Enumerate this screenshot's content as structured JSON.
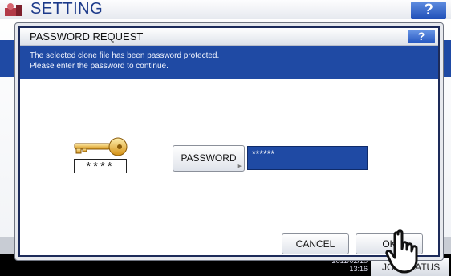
{
  "background": {
    "title": "SETTING",
    "help_label": "?",
    "datetime": "2011/02/10\n13:16",
    "job_status_label": "JOB STATUS"
  },
  "dialog": {
    "title": "PASSWORD REQUEST",
    "help_label": "?",
    "message_line1": "The selected clone file has been password protected.",
    "message_line2": "Please enter the password to continue.",
    "mask_text": "****",
    "password_button_label": "PASSWORD",
    "password_value": "******",
    "cancel_label": "CANCEL",
    "ok_label": "OK"
  },
  "colors": {
    "accent_blue": "#1f4aa4",
    "help_blue": "#2456c0",
    "key_gold": "#e9a51f"
  },
  "icons": [
    "setting-icon",
    "key-icon",
    "hand-cursor-icon",
    "corner-arrow-icon"
  ]
}
